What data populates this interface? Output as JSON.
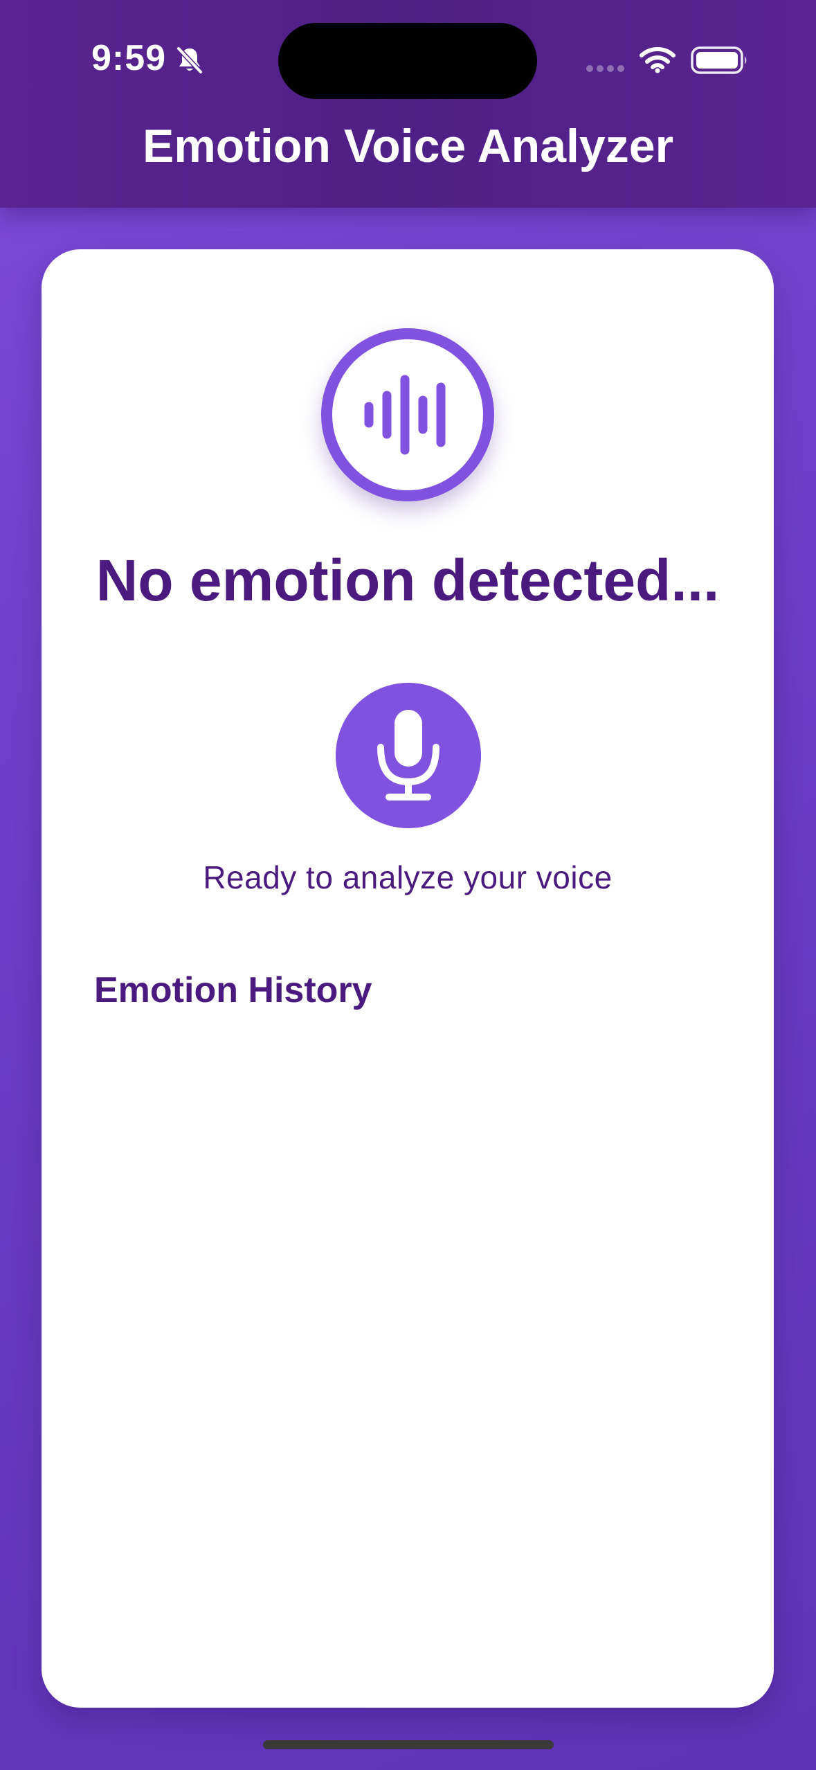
{
  "status_bar": {
    "time": "9:59",
    "icons": [
      "bell-slash-icon",
      "cellular-signal-icon",
      "wifi-icon",
      "battery-icon"
    ]
  },
  "header": {
    "title": "Emotion Voice Analyzer"
  },
  "main": {
    "indicator_icon": "waveform-icon",
    "emotion_status": "No emotion detected...",
    "record_button_icon": "microphone-icon",
    "ready_text": "Ready to analyze your voice",
    "history_heading": "Emotion History"
  },
  "colors": {
    "accent": "#8151e0",
    "header": "#4e1f85",
    "text_primary": "#4a1a7e",
    "background": "#6c3cc6",
    "card": "#ffffff"
  }
}
